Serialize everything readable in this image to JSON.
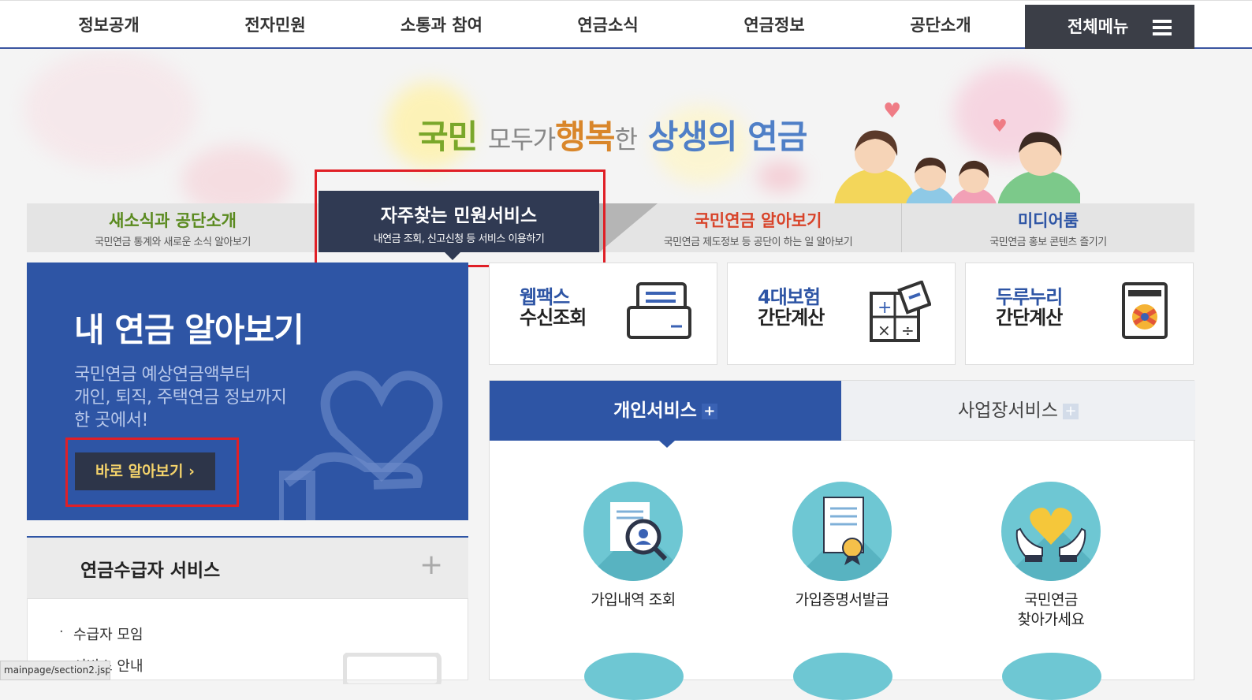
{
  "gnb": {
    "items": [
      "정보공개",
      "전자민원",
      "소통과 참여",
      "연금소식",
      "연금정보",
      "공단소개"
    ],
    "all_menu": "전체메뉴"
  },
  "hero": {
    "slogan": {
      "w1": "국민",
      "w2": "모두가",
      "w3": "행복",
      "w4": "한",
      "w5": "상생의 연금"
    }
  },
  "tabs": [
    {
      "title": "새소식과 공단소개",
      "sub": "국민연금 통계와 새로운 소식 알아보기",
      "color": "#5a8a1f"
    },
    {
      "title": "자주찾는 민원서비스",
      "sub": "내연금 조회, 신고신청 등 서비스 이용하기",
      "color": "#ffffff"
    },
    {
      "title": "국민연금 알아보기",
      "sub": "국민연금 제도정보 등 공단이 하는 일 알아보기",
      "color": "#d8442a"
    },
    {
      "title": "미디어룸",
      "sub": "국민연금 홍보 콘텐츠 즐기기",
      "color": "#2e55a5"
    }
  ],
  "mypension": {
    "title": "내 연금 알아보기",
    "desc": [
      "국민연금 예상연금액부터",
      "개인, 퇴직, 주택연금 정보까지",
      "한 곳에서!"
    ],
    "button": "바로 알아보기 ›"
  },
  "recipient": {
    "title": "연금수급자 서비스",
    "plus": "+",
    "items": [
      "수급자 모임",
      "서비스 안내"
    ]
  },
  "status_url": "mainpage/section2.jsp",
  "quick": [
    {
      "l1": "웹팩스",
      "l2": "수신조회",
      "icon": "fax-icon"
    },
    {
      "l1": "4대보험",
      "l2": "간단계산",
      "icon": "calculator-icon"
    },
    {
      "l1": "두루누리",
      "l2": "간단계산",
      "icon": "durunuri-icon"
    }
  ],
  "service_tabs": {
    "personal": "개인서비스",
    "business": "사업장서비스",
    "plus": "+"
  },
  "services": [
    {
      "label": [
        "가입내역 조회"
      ],
      "icon": "document-search-icon"
    },
    {
      "label": [
        "가입증명서발급"
      ],
      "icon": "certificate-icon"
    },
    {
      "label": [
        "국민연금",
        "찾아가세요"
      ],
      "icon": "heart-hands-icon"
    }
  ],
  "colors": {
    "primary": "#2e55a5",
    "dark": "#303a53",
    "highlight": "#e01f26",
    "teal": "#6ec7d3"
  }
}
